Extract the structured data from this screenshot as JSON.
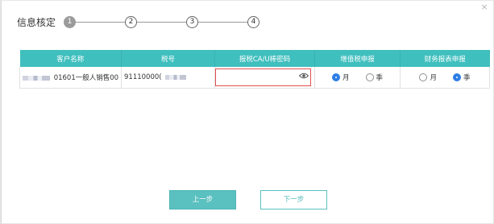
{
  "dialog": {
    "title": "信息核定",
    "close_label": "×",
    "steps": [
      "1",
      "2",
      "3",
      "4"
    ],
    "active_step": 1
  },
  "table": {
    "columns": [
      "客户名称",
      "税号",
      "报税CA/U棒密码",
      "增值税申报",
      "财务报表申报"
    ],
    "row": {
      "customer_name": "01601一般人销售00",
      "tax_id": "91110000(",
      "password_value": "",
      "vat_options": [
        "月",
        "季"
      ],
      "vat_selected": "月",
      "report_options": [
        "月",
        "季"
      ],
      "report_selected": "季"
    }
  },
  "buttons": {
    "prev": "上一步",
    "next": "下一步"
  },
  "colors": {
    "header_teal": "#3fbfbe",
    "radio_blue": "#2f7ee6",
    "error_red": "#e24f4f",
    "button_teal": "#5bc0c0"
  }
}
